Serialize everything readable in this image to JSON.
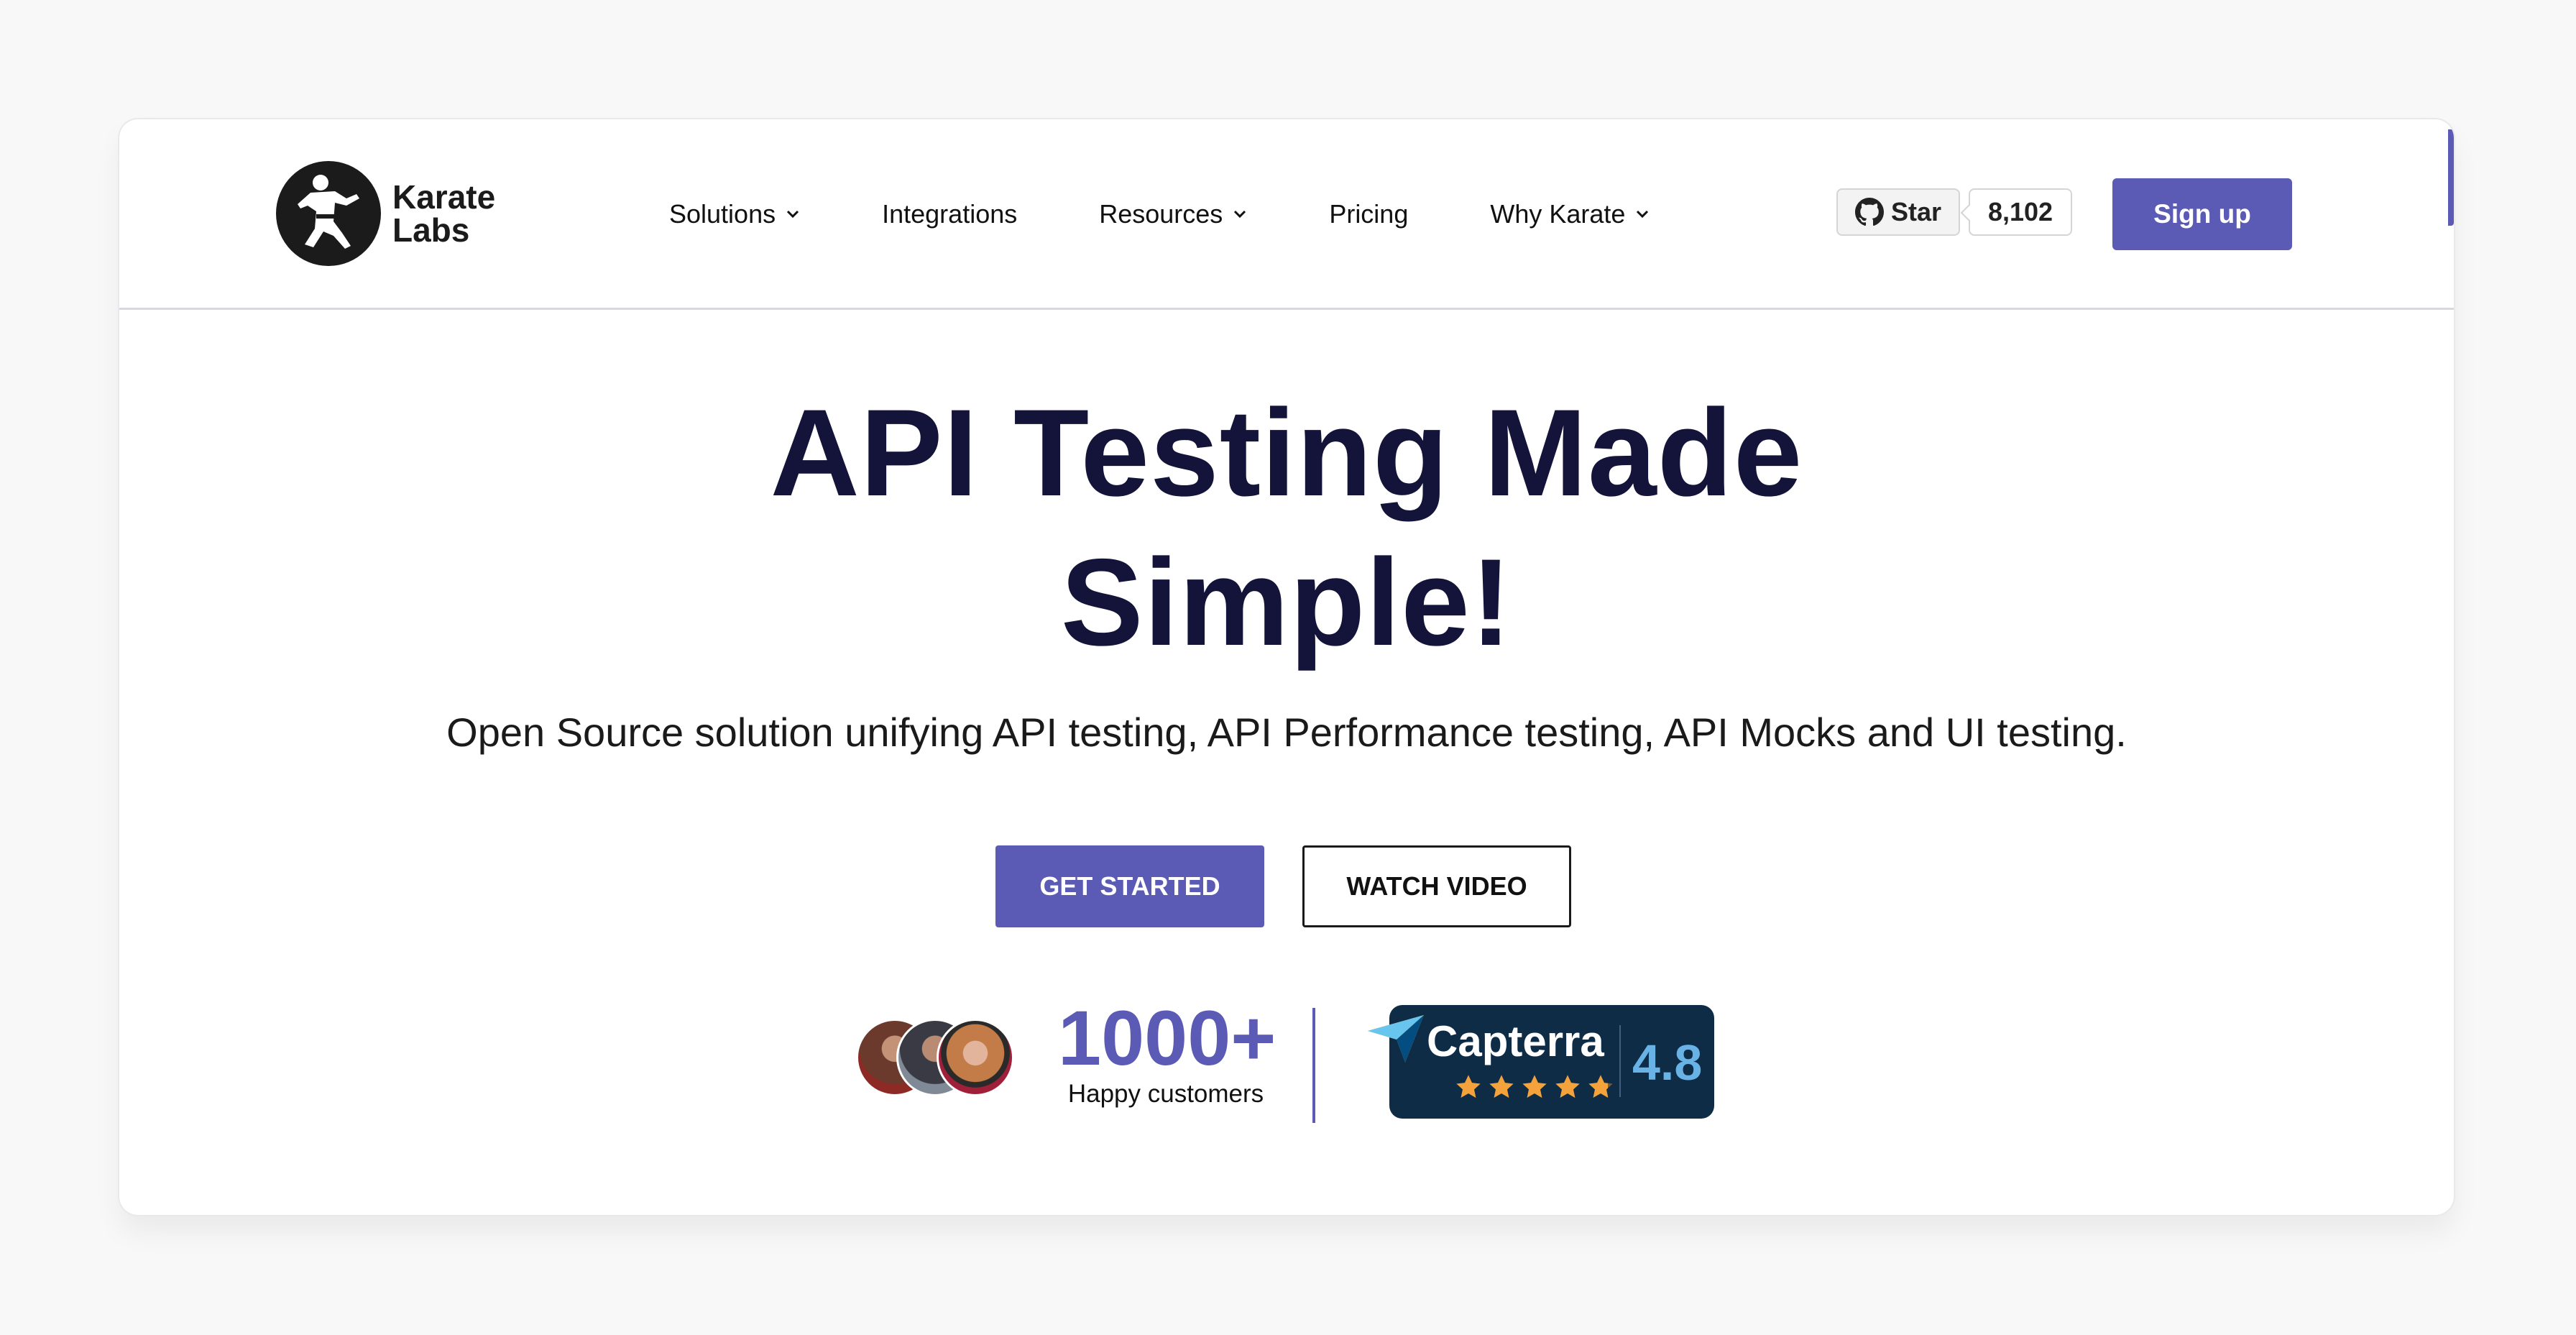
{
  "brand": {
    "line1": "Karate",
    "line2": "Labs"
  },
  "nav": {
    "items": [
      {
        "label": "Solutions",
        "dropdown": true
      },
      {
        "label": "Integrations",
        "dropdown": false
      },
      {
        "label": "Resources",
        "dropdown": true
      },
      {
        "label": "Pricing",
        "dropdown": false
      },
      {
        "label": "Why Karate",
        "dropdown": true
      }
    ]
  },
  "github": {
    "star_label": "Star",
    "count": "8,102"
  },
  "header": {
    "signup_label": "Sign up"
  },
  "hero": {
    "title_line1": "API Testing Made",
    "title_line2": "Simple!",
    "subtitle": "Open Source solution unifying API testing, API Performance testing, API Mocks and UI testing.",
    "primary_cta": "GET STARTED",
    "secondary_cta": "WATCH VIDEO"
  },
  "social_proof": {
    "customers_count": "1000+",
    "customers_label": "Happy customers"
  },
  "capterra": {
    "name": "Capterra",
    "rating": "4.8",
    "stars": 4.8
  },
  "colors": {
    "accent": "#5b5bb5",
    "title": "#14143a",
    "capterra_bg": "#0f2c47",
    "capterra_rating": "#69b2e6",
    "star": "#f4a23c"
  }
}
